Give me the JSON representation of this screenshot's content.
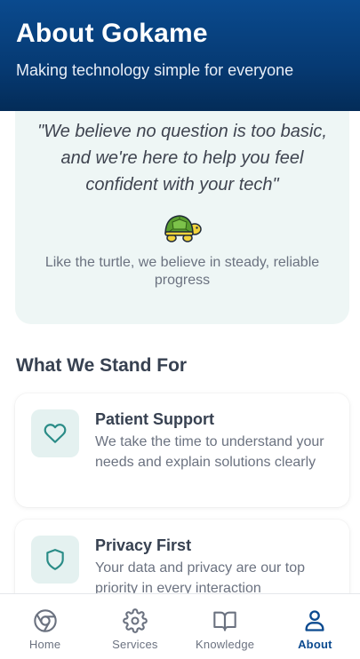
{
  "header": {
    "title": "About Gokame",
    "subtitle": "Making technology simple for everyone"
  },
  "quote": {
    "text": "\"We believe no question is too basic, and we're here to help you feel confident with your tech\"",
    "icon": "turtle-icon",
    "caption": "Like the turtle, we believe in steady, reliable progress"
  },
  "values": {
    "section_title": "What We Stand For",
    "items": [
      {
        "icon": "heart-icon",
        "title": "Patient Support",
        "description": "We take the time to understand your needs and explain solutions clearly"
      },
      {
        "icon": "shield-icon",
        "title": "Privacy First",
        "description": "Your data and privacy are our top priority in every interaction"
      }
    ]
  },
  "nav": {
    "active": "About",
    "items": [
      {
        "label": "Home",
        "icon": "chrome-icon"
      },
      {
        "label": "Services",
        "icon": "gear-icon"
      },
      {
        "label": "Knowledge",
        "icon": "book-icon"
      },
      {
        "label": "About",
        "icon": "user-icon"
      }
    ]
  },
  "colors": {
    "header_start": "#0a4a8e",
    "header_end": "#042c58",
    "accent_teal": "#2a8c87",
    "active_nav": "#0b4a8f",
    "card_tint": "#eef6f5"
  }
}
